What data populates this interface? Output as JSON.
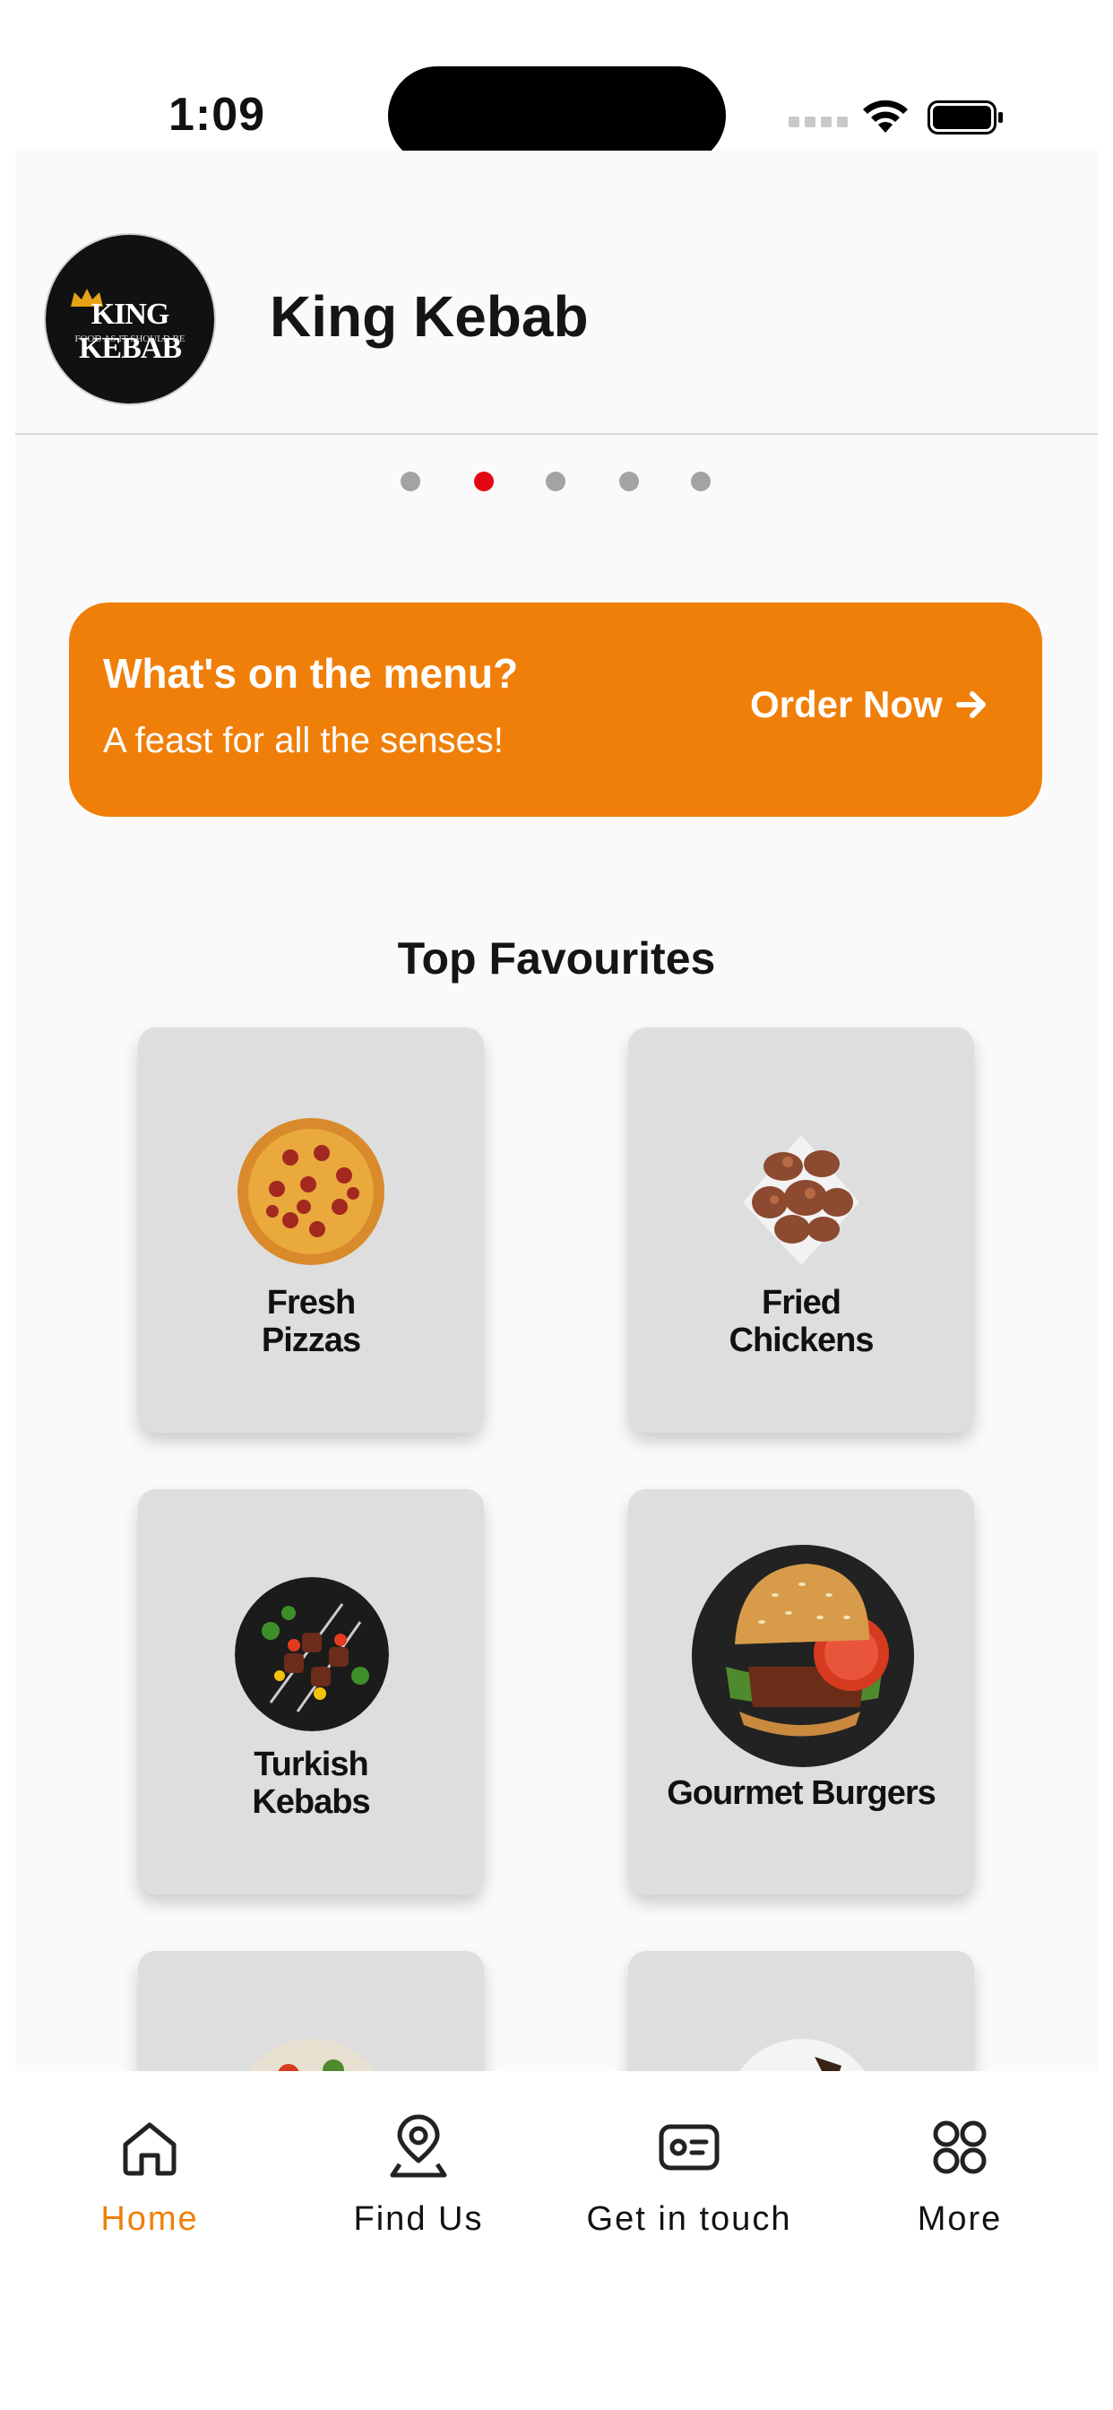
{
  "status_bar": {
    "time": "1:09"
  },
  "header": {
    "logo_text": "KING KEBAB",
    "logo_tagline": "FOOD AS IT SHOULD BE",
    "title": "King Kebab"
  },
  "carousel": {
    "count": 5,
    "active_index": 1
  },
  "banner": {
    "title": "What's on the menu?",
    "subtitle": "A feast for all the senses!",
    "button_label": "Order Now"
  },
  "section": {
    "title": "Top Favourites"
  },
  "cards": [
    {
      "label_line1": "Fresh",
      "label_line2": "Pizzas",
      "icon": "pizza-image"
    },
    {
      "label_line1": "Fried",
      "label_line2": "Chickens",
      "icon": "fried-chicken-image"
    },
    {
      "label_line1": "Turkish",
      "label_line2": "Kebabs",
      "icon": "kebab-image"
    },
    {
      "label_line1": "Gourmet Burgers",
      "icon": "burger-image"
    }
  ],
  "tab_bar": {
    "items": [
      {
        "label": "Home",
        "icon": "home-icon",
        "active": true
      },
      {
        "label": "Find Us",
        "icon": "location-pin-icon",
        "active": false
      },
      {
        "label": "Get in touch",
        "icon": "contact-card-icon",
        "active": false
      },
      {
        "label": "More",
        "icon": "grid-icon",
        "active": false
      }
    ]
  },
  "colors": {
    "accent": "#f07f09",
    "active_dot": "#e30613",
    "card_bg": "#dedede"
  }
}
